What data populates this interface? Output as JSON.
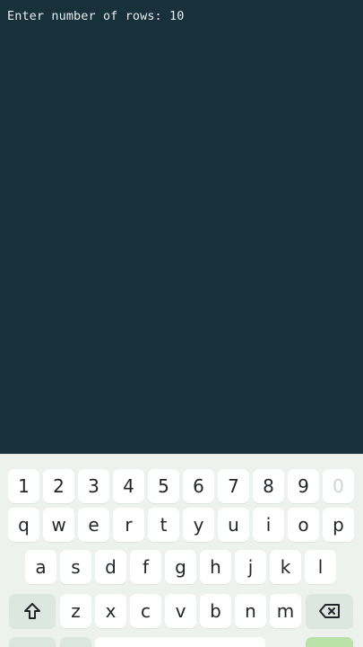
{
  "terminal": {
    "prompt_line": "Enter number of rows: 10"
  },
  "keyboard": {
    "number_row": [
      "1",
      "2",
      "3",
      "4",
      "5",
      "6",
      "7",
      "8",
      "9",
      "0"
    ],
    "row_1": [
      "q",
      "w",
      "e",
      "r",
      "t",
      "y",
      "u",
      "i",
      "o",
      "p"
    ],
    "row_2": [
      "a",
      "s",
      "d",
      "f",
      "g",
      "h",
      "j",
      "k",
      "l"
    ],
    "row_3": [
      "z",
      "x",
      "c",
      "v",
      "b",
      "n",
      "m"
    ],
    "icons": {
      "shift": "shift-icon",
      "backspace": "backspace-icon"
    }
  }
}
